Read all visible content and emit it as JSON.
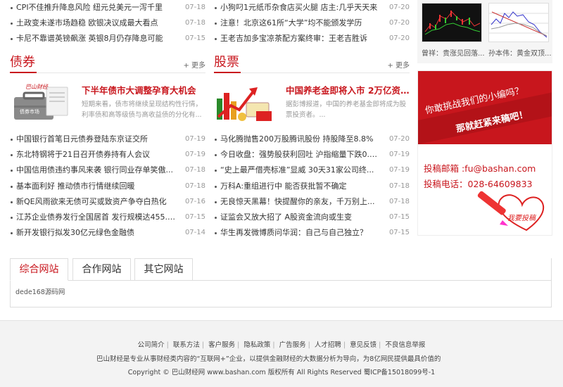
{
  "top_left_news": [
    {
      "title": "CPI不佳推升降息风险 纽元兑美元一泻千里",
      "date": "07-18"
    },
    {
      "title": "土政变未遂市场趋稳 欧银决议成最大看点",
      "date": "07-18"
    },
    {
      "title": "卡尼不靠谱英镑飙涨 英银8月仍存降息可能",
      "date": "07-15"
    }
  ],
  "top_mid_news": [
    {
      "title": "小狗叼1元纸币杂食店买火腿 店主:几乎天天来",
      "date": "07-20"
    },
    {
      "title": "注意！北京这61所“大学”均不能颁发学历",
      "date": "07-20"
    },
    {
      "title": "王老吉加多宝凉茶配方案终审：王老吉胜诉",
      "date": "07-20"
    }
  ],
  "chart_thumbs": [
    {
      "caption": "曾祥：贵涨见回落..."
    },
    {
      "caption": "孙本伟：黄金双顶..."
    }
  ],
  "bonds": {
    "title": "债券",
    "more": "+ 更多",
    "thumb_label": "债券市场",
    "thumb_brand": "巴山财经",
    "feature_title": "下半年债市大调整孕育大机会",
    "feature_desc": "短期来看，债市将继续呈现结构性行情，利率债和高等级债与高收益债的分化有...",
    "news": [
      {
        "title": "中国银行首笔日元债券登陆东京证交所",
        "date": "07-19"
      },
      {
        "title": "东北特钢将于21日召开债券持有人会议",
        "date": "07-19"
      },
      {
        "title": "中国信用债违约事风来袭 银行同业存单笑傲...",
        "date": "07-18"
      },
      {
        "title": "基本面利好 推动债市行情继续回暖",
        "date": "07-18"
      },
      {
        "title": "新QE风雨欲来无债可买或致资产争夺白热化",
        "date": "07-16"
      },
      {
        "title": "江苏企业债券发行全国居首 发行规模达455.8...",
        "date": "07-15"
      },
      {
        "title": "新开发银行拟发30亿元绿色金融债",
        "date": "07-14"
      }
    ]
  },
  "stocks": {
    "title": "股票",
    "more": "+ 更多",
    "feature_title": "中国养老金即将入市 2万亿资...",
    "feature_desc": "据彭博报道，中国的养老基金即将成为股票投资者。...",
    "news": [
      {
        "title": "马化腾抛售200万股腾讯股份 持股降至8.8%",
        "date": "07-20"
      },
      {
        "title": "今日收盘：强势股获利回吐 沪指缩量下跌0.2...",
        "date": "07-19"
      },
      {
        "title": "“史上最严借壳标准”显威 30天31家公司终...",
        "date": "07-19"
      },
      {
        "title": "万科A:重组进行中 能否获批暂不确定",
        "date": "07-18"
      },
      {
        "title": "无良惊天黑幕！快提醒你的亲友，千万别上...",
        "date": "07-18"
      },
      {
        "title": "证监会又放大招了 A股资金流向或生变",
        "date": "07-15"
      },
      {
        "title": "华生再发微博质问华润：自己与自己独立？",
        "date": "07-15"
      }
    ]
  },
  "contribute": {
    "banner_line1": "你敢挑战我们的小编吗？",
    "banner_line2": "那就赶紧来稿吧！",
    "email": "投稿邮箱 :fu@bashan.com",
    "phone": "投稿电话：028-64609833",
    "stamp": "我要投稿"
  },
  "tabs": {
    "items": [
      "综合网站",
      "合作网站",
      "其它网站"
    ],
    "content": "dede168源码网"
  },
  "footer": {
    "links": [
      "公司简介",
      "联系方法",
      "客户服务",
      "隐私政策",
      "广告服务",
      "人才招聘",
      "意见反馈",
      "不良信息举报"
    ],
    "desc": "巴山财经是专业从事财经类内容的“互联网+”企业，以提供金融财经的大数据分析为导向，为8亿网民提供最具价值的财",
    "copyright": "Copyright © 巴山财经网 www.bashan.com 版权所有 All Rights Reserved 蜀ICP备15018099号-1"
  },
  "colors": {
    "accent": "#c8161d",
    "date": "#999999"
  }
}
